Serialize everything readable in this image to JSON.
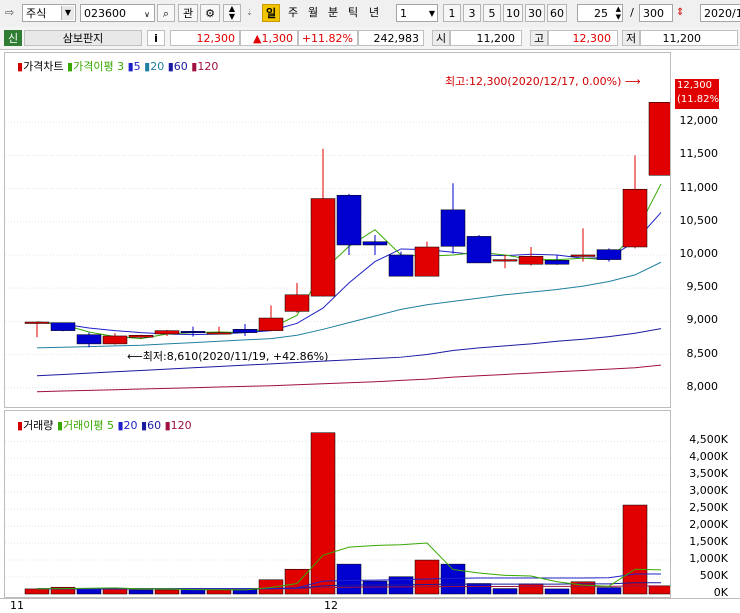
{
  "toolbar": {
    "market": "주식",
    "code": "023600",
    "search_icon": "magnifier-icon",
    "gwan_label": "관",
    "periods": [
      "일",
      "주",
      "월",
      "분",
      "틱",
      "년"
    ],
    "selected_period": "일",
    "interval": "1",
    "quick_intervals": [
      "1",
      "3",
      "5",
      "10",
      "30",
      "60"
    ],
    "bars_visible": "25",
    "bars_total": "300",
    "date": "2020/1"
  },
  "info": {
    "tag": "신",
    "name": "삼보판지",
    "info_btn": "i",
    "price": "12,300",
    "change": "▲1,300",
    "change_pct": "+11.82%",
    "volume": "242,983",
    "open_label": "시",
    "open": "11,200",
    "high_label": "고",
    "high": "12,300",
    "low_label": "저",
    "low": "11,200"
  },
  "price_panel": {
    "legend_title": "가격차트",
    "legend_ma_title": "가격이평",
    "legend_periods": [
      "3",
      "5",
      "20",
      "60",
      "120"
    ],
    "current_price_tag": "12,300",
    "current_pct_tag": "(11.82%)",
    "max_annotation": "최고:12,300(2020/12/17, 0.00%)",
    "min_annotation": "최저:8,610(2020/11/19, +42.86%)"
  },
  "volume_panel": {
    "legend_title": "거래량",
    "legend_ma_title": "거래이평",
    "legend_periods": [
      "5",
      "20",
      "60",
      "120"
    ]
  },
  "x_axis": {
    "labels": [
      "11",
      "12"
    ]
  },
  "colors": {
    "up": "#e00000",
    "down": "#0000d0",
    "ma3": "#38a800",
    "ma5": "#2020c8",
    "ma20": "#2080a0",
    "ma60": "#1a1aa0",
    "ma120": "#a01040",
    "vol_ma5": "#38a800"
  },
  "chart_data": [
    {
      "type": "candlestick",
      "title": "가격차트",
      "y_ticks": [
        8000,
        8500,
        9000,
        9500,
        10000,
        10500,
        11000,
        11500,
        12000
      ],
      "ylim": [
        7800,
        12500
      ],
      "candles": [
        {
          "o": 8990,
          "h": 9000,
          "l": 8760,
          "c": 8990
        },
        {
          "o": 8980,
          "h": 8980,
          "l": 8850,
          "c": 8860
        },
        {
          "o": 8800,
          "h": 8830,
          "l": 8610,
          "c": 8660
        },
        {
          "o": 8660,
          "h": 8820,
          "l": 8650,
          "c": 8780
        },
        {
          "o": 8760,
          "h": 8800,
          "l": 8740,
          "c": 8790
        },
        {
          "o": 8810,
          "h": 8870,
          "l": 8780,
          "c": 8860
        },
        {
          "o": 8850,
          "h": 8920,
          "l": 8770,
          "c": 8830
        },
        {
          "o": 8820,
          "h": 8920,
          "l": 8800,
          "c": 8830
        },
        {
          "o": 8880,
          "h": 8960,
          "l": 8780,
          "c": 8830
        },
        {
          "o": 8860,
          "h": 9240,
          "l": 8850,
          "c": 9050
        },
        {
          "o": 9150,
          "h": 9580,
          "l": 9130,
          "c": 9400
        },
        {
          "o": 9380,
          "h": 11600,
          "l": 9380,
          "c": 10850
        },
        {
          "o": 10900,
          "h": 10920,
          "l": 10000,
          "c": 10150
        },
        {
          "o": 10200,
          "h": 10300,
          "l": 10000,
          "c": 10150
        },
        {
          "o": 10000,
          "h": 10050,
          "l": 9680,
          "c": 9680
        },
        {
          "o": 9680,
          "h": 10200,
          "l": 9680,
          "c": 10120
        },
        {
          "o": 10680,
          "h": 11080,
          "l": 10020,
          "c": 10130
        },
        {
          "o": 10280,
          "h": 10300,
          "l": 9880,
          "c": 9880
        },
        {
          "o": 9920,
          "h": 10000,
          "l": 9800,
          "c": 9930
        },
        {
          "o": 9860,
          "h": 10120,
          "l": 9840,
          "c": 9980
        },
        {
          "o": 9920,
          "h": 10000,
          "l": 9850,
          "c": 9860
        },
        {
          "o": 10000,
          "h": 10400,
          "l": 9900,
          "c": 10000
        },
        {
          "o": 10080,
          "h": 10100,
          "l": 9900,
          "c": 9930
        },
        {
          "o": 10120,
          "h": 11500,
          "l": 10100,
          "c": 10990
        },
        {
          "o": 11200,
          "h": 12300,
          "l": 11200,
          "c": 12300
        }
      ],
      "ma3": [
        8990,
        8950,
        8840,
        8770,
        8740,
        8810,
        8830,
        8840,
        8830,
        8900,
        9090,
        9760,
        10130,
        10380,
        10000,
        9980,
        10000,
        10040,
        10000,
        9930,
        9930,
        9950,
        9930,
        10310,
        11070
      ],
      "ma5": [
        8990,
        8960,
        8900,
        8860,
        8830,
        8810,
        8800,
        8810,
        8830,
        8860,
        8970,
        9200,
        9580,
        9900,
        10090,
        10080,
        10040,
        10000,
        9990,
        10010,
        10000,
        9950,
        9960,
        10200,
        10640
      ],
      "ma20": [
        8600,
        8610,
        8620,
        8630,
        8640,
        8660,
        8680,
        8700,
        8720,
        8740,
        8790,
        8880,
        8980,
        9080,
        9180,
        9250,
        9300,
        9350,
        9400,
        9440,
        9480,
        9530,
        9600,
        9700,
        9890
      ],
      "ma60": [
        8180,
        8200,
        8220,
        8240,
        8260,
        8280,
        8300,
        8320,
        8340,
        8360,
        8380,
        8400,
        8420,
        8440,
        8460,
        8500,
        8560,
        8600,
        8630,
        8660,
        8700,
        8730,
        8770,
        8820,
        8890
      ],
      "ma120": [
        7940,
        7950,
        7960,
        7970,
        7980,
        7990,
        8000,
        8010,
        8020,
        8030,
        8045,
        8060,
        8075,
        8090,
        8110,
        8130,
        8160,
        8180,
        8200,
        8220,
        8240,
        8260,
        8280,
        8300,
        8340
      ]
    },
    {
      "type": "bar",
      "title": "거래량",
      "y_ticks": [
        0,
        500,
        1000,
        1500,
        2000,
        2500,
        3000,
        3500,
        4000,
        4500
      ],
      "y_tick_labels": [
        "0K",
        "500K",
        "1,000K",
        "1,500K",
        "2,000K",
        "2,500K",
        "3,000K",
        "3,500K",
        "4,000K",
        "4,500K"
      ],
      "ylim": [
        0,
        4800
      ],
      "values": [
        150,
        200,
        150,
        150,
        120,
        120,
        130,
        120,
        130,
        420,
        730,
        4750,
        880,
        380,
        510,
        1000,
        880,
        310,
        160,
        300,
        150,
        360,
        190,
        2620,
        240
      ],
      "up": [
        true,
        true,
        false,
        true,
        false,
        true,
        false,
        true,
        false,
        true,
        true,
        true,
        false,
        false,
        false,
        true,
        false,
        false,
        false,
        true,
        false,
        true,
        false,
        true,
        true
      ],
      "ma5": [
        150,
        160,
        170,
        180,
        150,
        150,
        130,
        130,
        120,
        190,
        310,
        1140,
        1380,
        1430,
        1450,
        1500,
        720,
        620,
        550,
        530,
        360,
        260,
        230,
        730,
        710
      ],
      "ma20": [
        150,
        150,
        150,
        150,
        150,
        150,
        150,
        150,
        150,
        160,
        180,
        380,
        400,
        410,
        420,
        440,
        460,
        470,
        470,
        470,
        470,
        470,
        480,
        590,
        590
      ],
      "ma60": [
        160,
        160,
        160,
        160,
        160,
        160,
        160,
        160,
        160,
        160,
        170,
        240,
        260,
        270,
        270,
        280,
        290,
        290,
        290,
        290,
        290,
        300,
        300,
        330,
        330
      ],
      "ma120": [
        150,
        150,
        150,
        150,
        150,
        150,
        150,
        150,
        150,
        150,
        155,
        190,
        200,
        205,
        210,
        215,
        220,
        220,
        220,
        225,
        225,
        225,
        225,
        240,
        240
      ]
    }
  ]
}
